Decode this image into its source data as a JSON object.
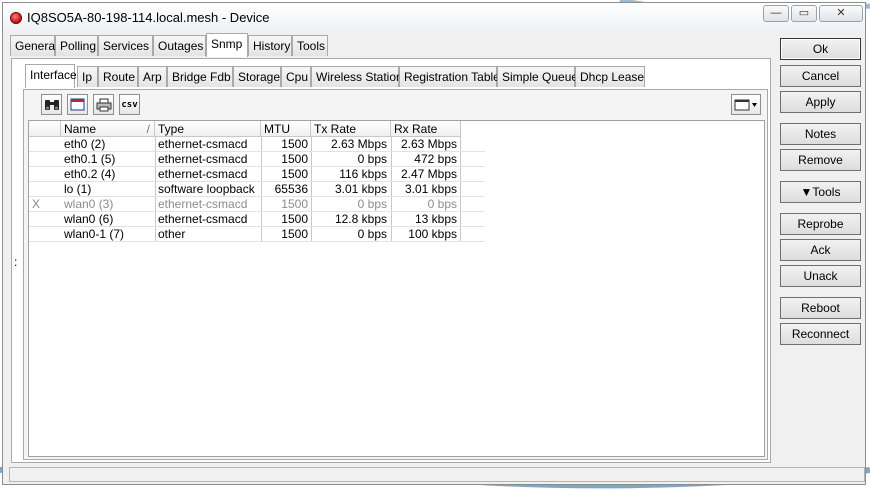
{
  "window": {
    "title": "IQ8SO5A-80-198-114.local.mesh - Device",
    "controls": {
      "minimize": "—",
      "maximize": "▭",
      "close": "✕"
    }
  },
  "main_tabs": [
    "General",
    "Polling",
    "Services",
    "Outages",
    "Snmp",
    "History",
    "Tools"
  ],
  "main_active_tab": "Snmp",
  "sub_tabs": [
    "Interface",
    "Ip",
    "Route",
    "Arp",
    "Bridge Fdb",
    "Storage",
    "Cpu",
    "Wireless Station",
    "Registration Table",
    "Simple Queue",
    "Dhcp Lease"
  ],
  "sub_active_tab": "Interface",
  "toolbar": {
    "find_icon": "binoculars-icon",
    "calendar_icon": "calendar-icon",
    "print_icon": "printer-icon",
    "csv_label": "csv",
    "columns_icon": "columns-icon"
  },
  "table": {
    "columns": {
      "name": "Name",
      "type": "Type",
      "mtu": "MTU",
      "tx": "Tx Rate",
      "rx": "Rx Rate"
    },
    "sort_indicator": "/",
    "rows": [
      {
        "flag": "",
        "name": "eth0 (2)",
        "type": "ethernet-csmacd",
        "mtu": "1500",
        "tx": "2.63 Mbps",
        "rx": "2.63 Mbps"
      },
      {
        "flag": "",
        "name": "eth0.1 (5)",
        "type": "ethernet-csmacd",
        "mtu": "1500",
        "tx": "0 bps",
        "rx": "472 bps"
      },
      {
        "flag": "",
        "name": "eth0.2 (4)",
        "type": "ethernet-csmacd",
        "mtu": "1500",
        "tx": "116 kbps",
        "rx": "2.47 Mbps"
      },
      {
        "flag": "",
        "name": "lo (1)",
        "type": "software loopback",
        "mtu": "65536",
        "tx": "3.01 kbps",
        "rx": "3.01 kbps"
      },
      {
        "flag": "X",
        "name": "wlan0 (3)",
        "type": "ethernet-csmacd",
        "mtu": "1500",
        "tx": "0 bps",
        "rx": "0 bps"
      },
      {
        "flag": "",
        "name": "wlan0 (6)",
        "type": "ethernet-csmacd",
        "mtu": "1500",
        "tx": "12.8 kbps",
        "rx": "13 kbps"
      },
      {
        "flag": "",
        "name": "wlan0-1 (7)",
        "type": "other",
        "mtu": "1500",
        "tx": "0 bps",
        "rx": "100 kbps"
      }
    ]
  },
  "side_marker": ":",
  "buttons": {
    "ok": "Ok",
    "cancel": "Cancel",
    "apply": "Apply",
    "notes": "Notes",
    "remove": "Remove",
    "tools": "▼Tools",
    "reprobe": "Reprobe",
    "ack": "Ack",
    "unack": "Unack",
    "reboot": "Reboot",
    "reconnect": "Reconnect"
  },
  "colors": {
    "disabled_row_text": "#8c8c8c",
    "window_bg": "#f0f0f0"
  }
}
